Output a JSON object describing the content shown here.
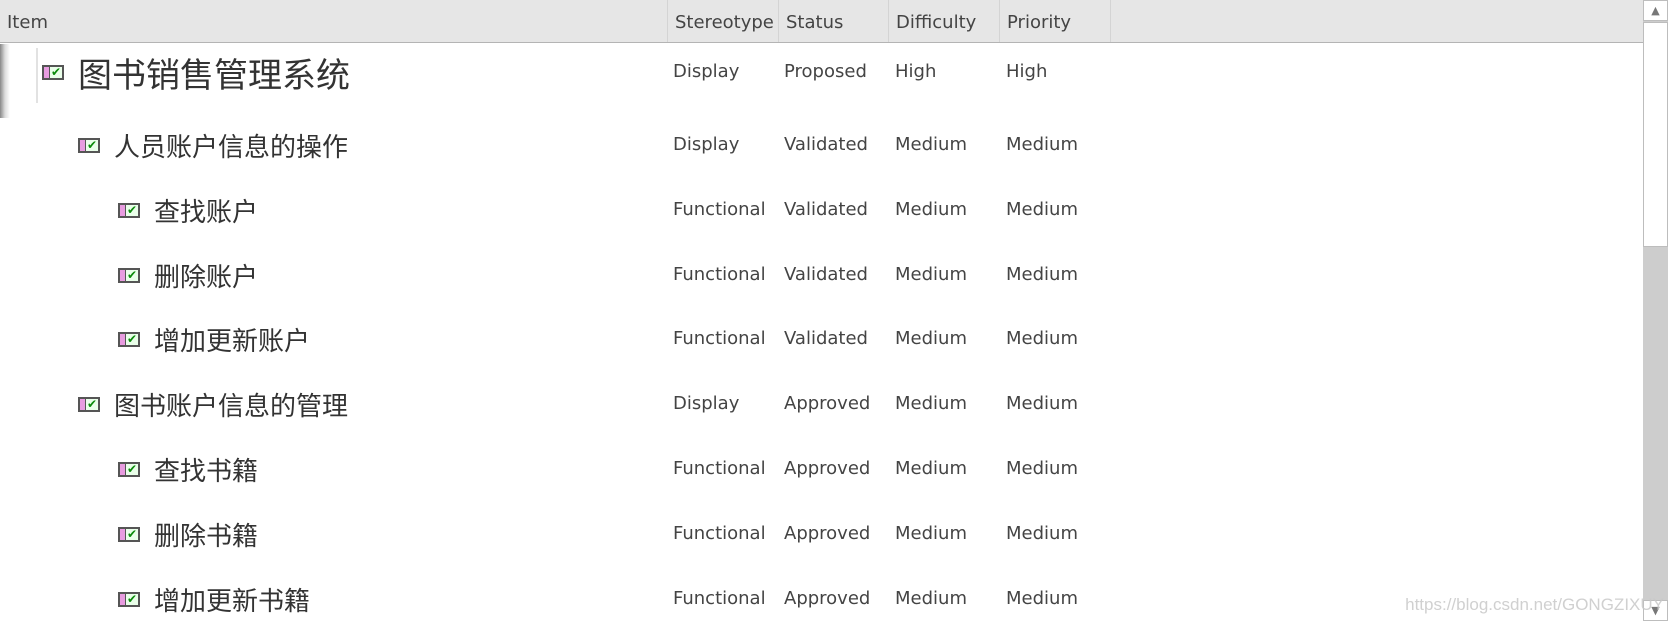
{
  "columns": [
    "Item",
    "Stereotype",
    "Status",
    "Difficulty",
    "Priority"
  ],
  "rows": [
    {
      "name": "图书销售管理系统",
      "level": 0,
      "stereotype": "Display",
      "status": "Proposed",
      "difficulty": "High",
      "priority": "High"
    },
    {
      "name": "人员账户信息的操作",
      "level": 1,
      "stereotype": "Display",
      "status": "Validated",
      "difficulty": "Medium",
      "priority": "Medium"
    },
    {
      "name": "查找账户",
      "level": 2,
      "stereotype": "Functional",
      "status": "Validated",
      "difficulty": "Medium",
      "priority": "Medium"
    },
    {
      "name": "删除账户",
      "level": 2,
      "stereotype": "Functional",
      "status": "Validated",
      "difficulty": "Medium",
      "priority": "Medium"
    },
    {
      "name": "增加更新账户",
      "level": 2,
      "stereotype": "Functional",
      "status": "Validated",
      "difficulty": "Medium",
      "priority": "Medium"
    },
    {
      "name": "图书账户信息的管理",
      "level": 1,
      "stereotype": "Display",
      "status": "Approved",
      "difficulty": "Medium",
      "priority": "Medium"
    },
    {
      "name": "查找书籍",
      "level": 2,
      "stereotype": "Functional",
      "status": "Approved",
      "difficulty": "Medium",
      "priority": "Medium"
    },
    {
      "name": "删除书籍",
      "level": 2,
      "stereotype": "Functional",
      "status": "Approved",
      "difficulty": "Medium",
      "priority": "Medium"
    },
    {
      "name": "增加更新书籍",
      "level": 2,
      "stereotype": "Functional",
      "status": "Approved",
      "difficulty": "Medium",
      "priority": "Medium"
    }
  ],
  "icons": {
    "requirement": "requirement-checked-icon",
    "scroll_up": "arrow-up-icon",
    "scroll_down": "arrow-down-icon"
  },
  "watermark": "https://blog.csdn.net/GONGZIXUY"
}
